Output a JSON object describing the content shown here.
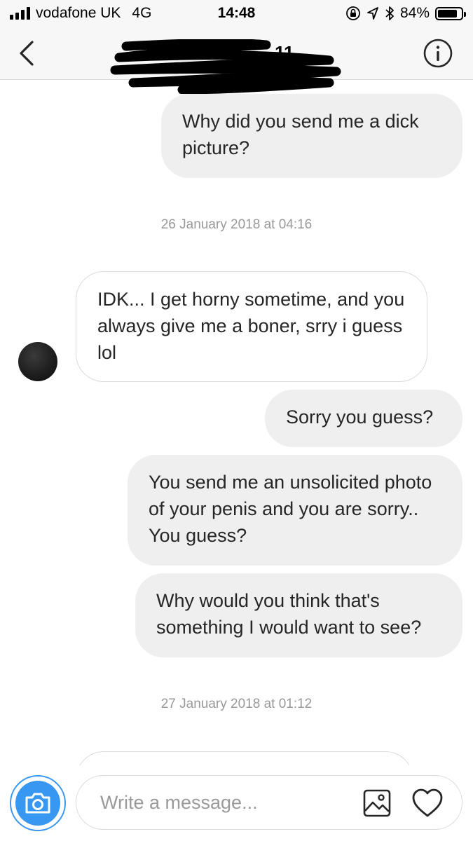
{
  "status_bar": {
    "carrier": "vodafone UK",
    "network": "4G",
    "time": "14:48",
    "battery_text": "84%",
    "battery_level": 0.84,
    "icons": [
      "signal-bars-icon",
      "orientation-lock-icon",
      "location-arrow-icon",
      "bluetooth-icon",
      "battery-icon"
    ]
  },
  "header": {
    "title_visible_fragment": "11",
    "back_icon": "chevron-left-icon",
    "info_icon": "info-circle-icon"
  },
  "messages": [
    {
      "type": "message",
      "direction": "sent",
      "text": "Why did you send me a dick picture?"
    },
    {
      "type": "timestamp",
      "text": "26 January 2018 at 04:16"
    },
    {
      "type": "message",
      "direction": "received",
      "text": "IDK... I get horny sometime, and you always give me a boner, srry i guess lol"
    },
    {
      "type": "message",
      "direction": "sent",
      "text": "Sorry you guess?"
    },
    {
      "type": "message",
      "direction": "sent",
      "text": "You send me an unsolicited photo of your penis and you are sorry.. You guess?"
    },
    {
      "type": "message",
      "direction": "sent",
      "text": "Why would you think that's something I would want to see?"
    },
    {
      "type": "timestamp",
      "text": "27 January 2018 at 01:12"
    },
    {
      "type": "message",
      "direction": "received",
      "text": ""
    }
  ],
  "composer": {
    "placeholder": "Write a message...",
    "value": "",
    "camera_icon": "camera-icon",
    "gallery_icon": "gallery-icon",
    "like_icon": "heart-icon"
  },
  "colors": {
    "accent": "#3897f0",
    "sent_bubble": "#efefef",
    "border": "#dbdbdb",
    "timestamp": "#999999"
  }
}
